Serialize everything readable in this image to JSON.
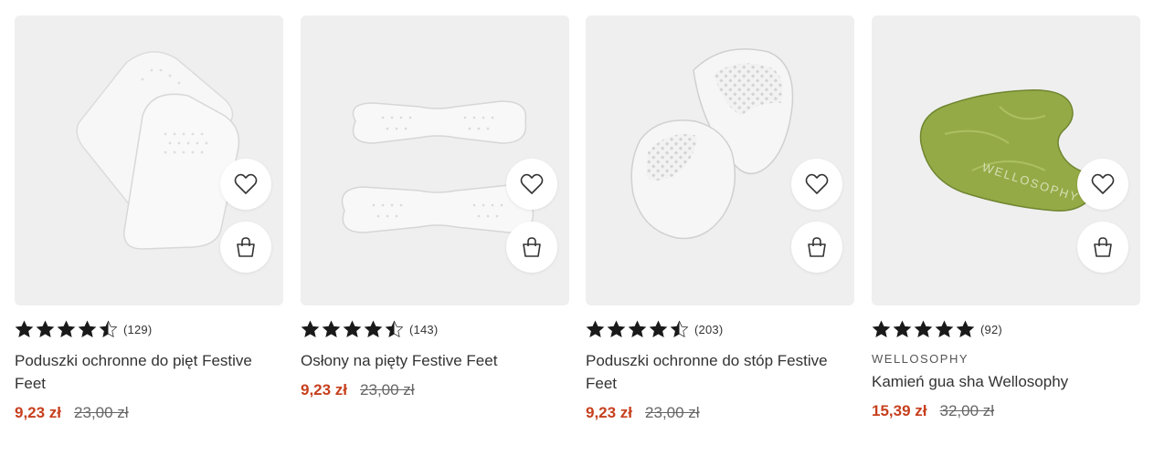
{
  "products": [
    {
      "rating": 4.5,
      "review_count": "(129)",
      "brand": "",
      "title": "Poduszki ochronne do pięt Festive Feet",
      "price": "9,23 zł",
      "old_price": "23,00 zł",
      "image": "heel-cushions-image"
    },
    {
      "rating": 4.5,
      "review_count": "(143)",
      "brand": "",
      "title": "Osłony na pięty Festive Feet",
      "price": "9,23 zł",
      "old_price": "23,00 zł",
      "image": "heel-grips-image"
    },
    {
      "rating": 4.5,
      "review_count": "(203)",
      "brand": "",
      "title": "Poduszki ochronne do stóp Festive Feet",
      "price": "9,23 zł",
      "old_price": "23,00 zł",
      "image": "ball-of-foot-cushions-image"
    },
    {
      "rating": 5,
      "review_count": "(92)",
      "brand": "WELLOSOPHY",
      "title": "Kamień gua sha Wellosophy",
      "price": "15,39 zł",
      "old_price": "32,00 zł",
      "image": "gua-sha-stone-image",
      "image_logo_text": "WELLOSOPHY"
    }
  ],
  "icons": {
    "wishlist": "heart-icon",
    "cart": "shopping-bag-icon",
    "star": "star-icon"
  },
  "colors": {
    "price": "#c7401e",
    "star": "#1a1a1a",
    "image_bg": "#efefef",
    "jade": "#8fa544"
  }
}
